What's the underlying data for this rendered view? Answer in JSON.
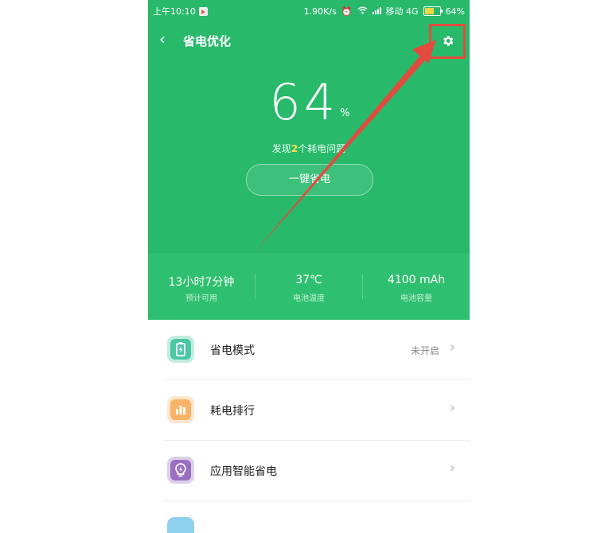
{
  "statusbar": {
    "time": "上午10:10",
    "speed": "1.90K/s",
    "carrier": "移动 4G",
    "battery": "64%"
  },
  "header": {
    "title": "省电优化",
    "back_icon": "chevron-left-icon",
    "settings_icon": "gear-icon"
  },
  "battery": {
    "percent": "64",
    "unit": "%",
    "issues_prefix": "发现",
    "issues_count": "2",
    "issues_suffix": "个耗电问题"
  },
  "one_key_button": "一键省电",
  "stats": [
    {
      "value": "13小时7分钟",
      "label": "预计可用"
    },
    {
      "value": "37℃",
      "label": "电池温度"
    },
    {
      "value": "4100 mAh",
      "label": "电池容量"
    }
  ],
  "menu": [
    {
      "label": "省电模式",
      "value": "未开启",
      "icon": "battery-icon",
      "color": "#4cc7a6"
    },
    {
      "label": "耗电排行",
      "value": "",
      "icon": "bar-chart-icon",
      "color": "#f8b368"
    },
    {
      "label": "应用智能省电",
      "value": "",
      "icon": "lightbulb-icon",
      "color": "#9a6fc0"
    }
  ],
  "colors": {
    "accent_green": "#28b96b",
    "annotation_red": "#e34b3f"
  }
}
